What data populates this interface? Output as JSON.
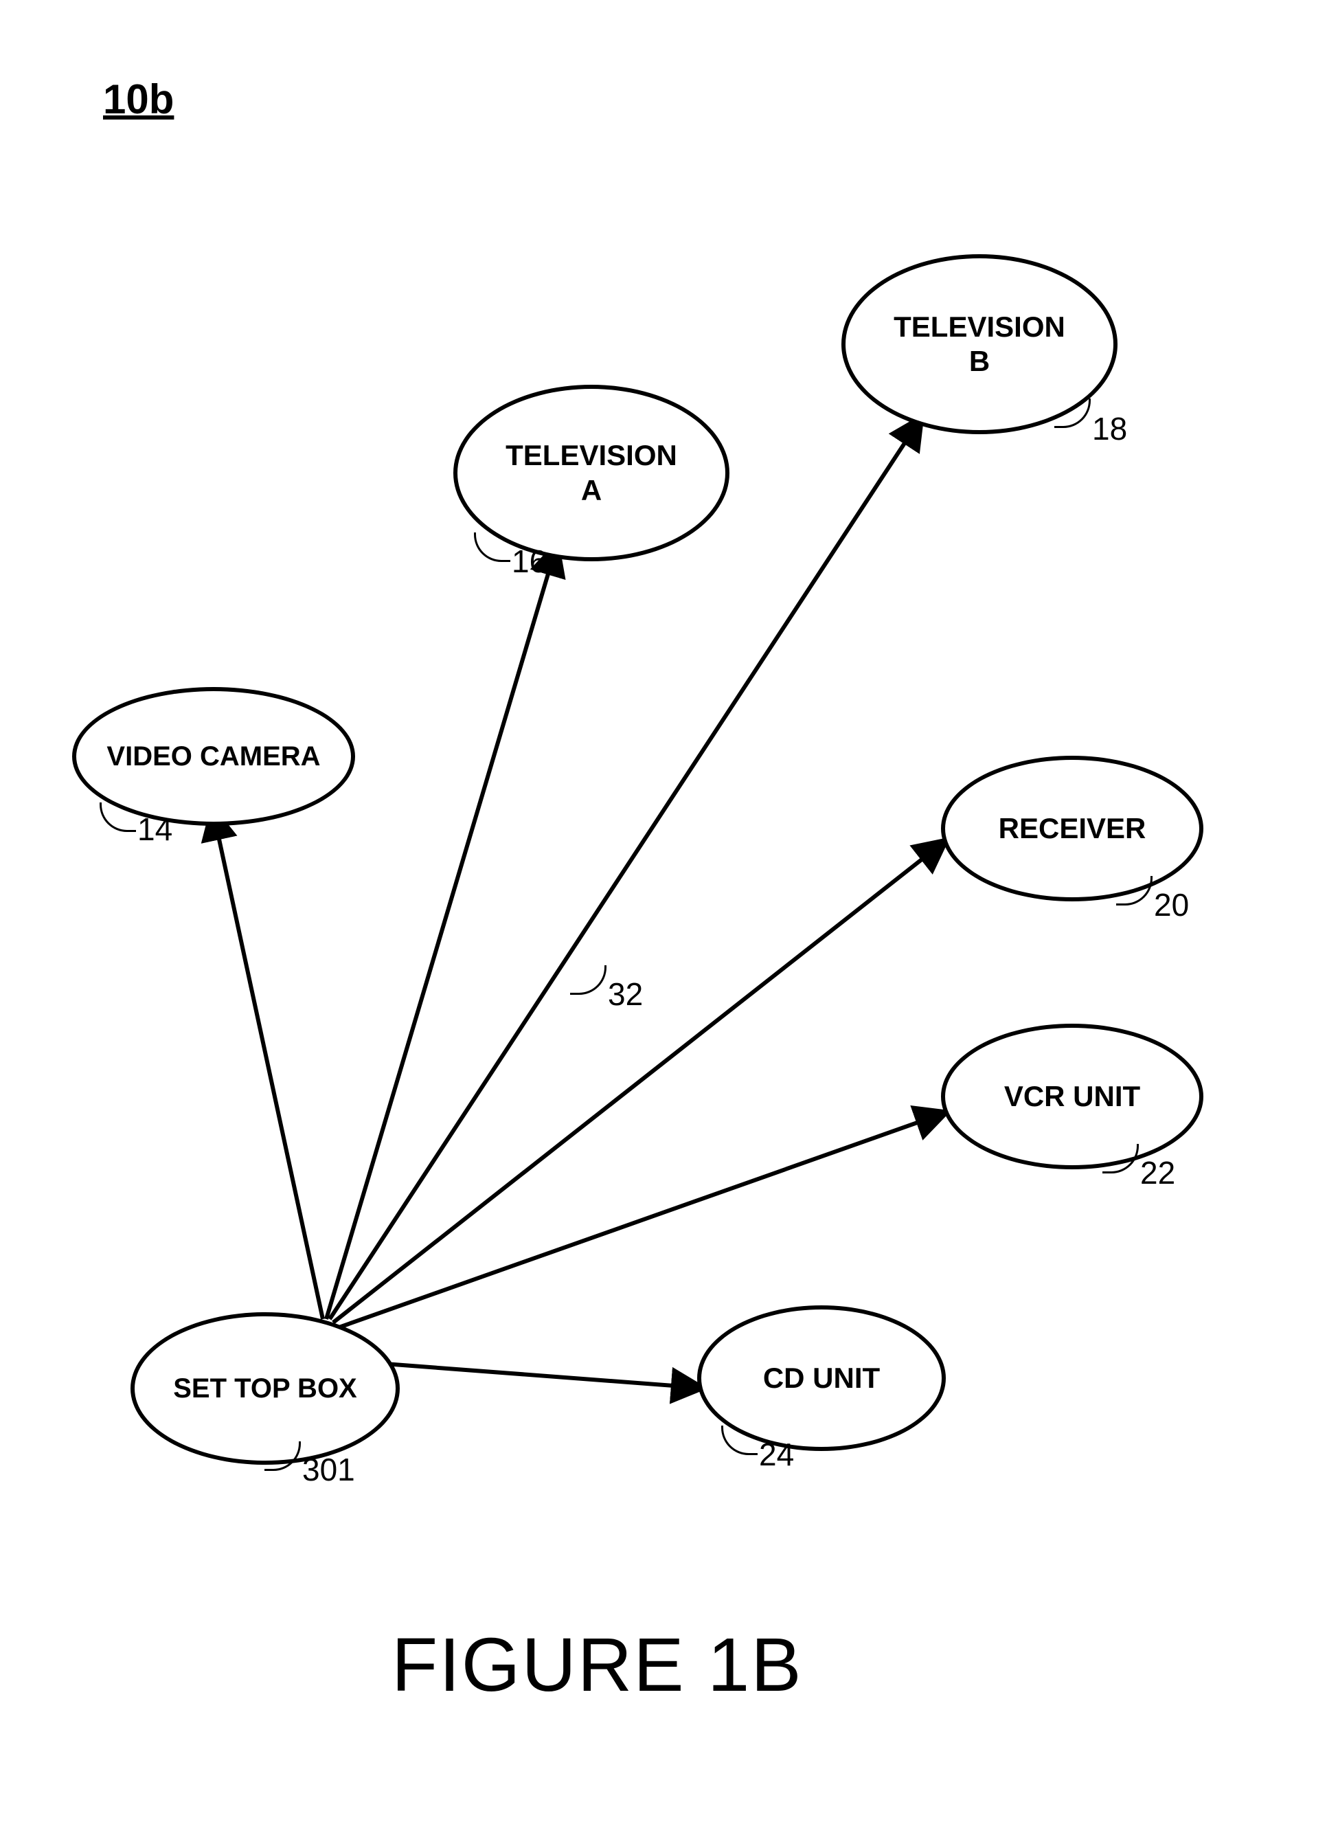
{
  "figure_id": "10b",
  "caption": "FIGURE 1B",
  "nodes": {
    "video_camera": {
      "label": "VIDEO CAMERA",
      "ref": "14"
    },
    "tv_a": {
      "label": "TELEVISION\nA",
      "ref": "16"
    },
    "tv_b": {
      "label": "TELEVISION\nB",
      "ref": "18"
    },
    "receiver": {
      "label": "RECEIVER",
      "ref": "20"
    },
    "vcr": {
      "label": "VCR UNIT",
      "ref": "22"
    },
    "cd": {
      "label": "CD UNIT",
      "ref": "24"
    },
    "stb": {
      "label": "SET TOP BOX",
      "ref": "301"
    }
  },
  "arrow_ref": "32"
}
